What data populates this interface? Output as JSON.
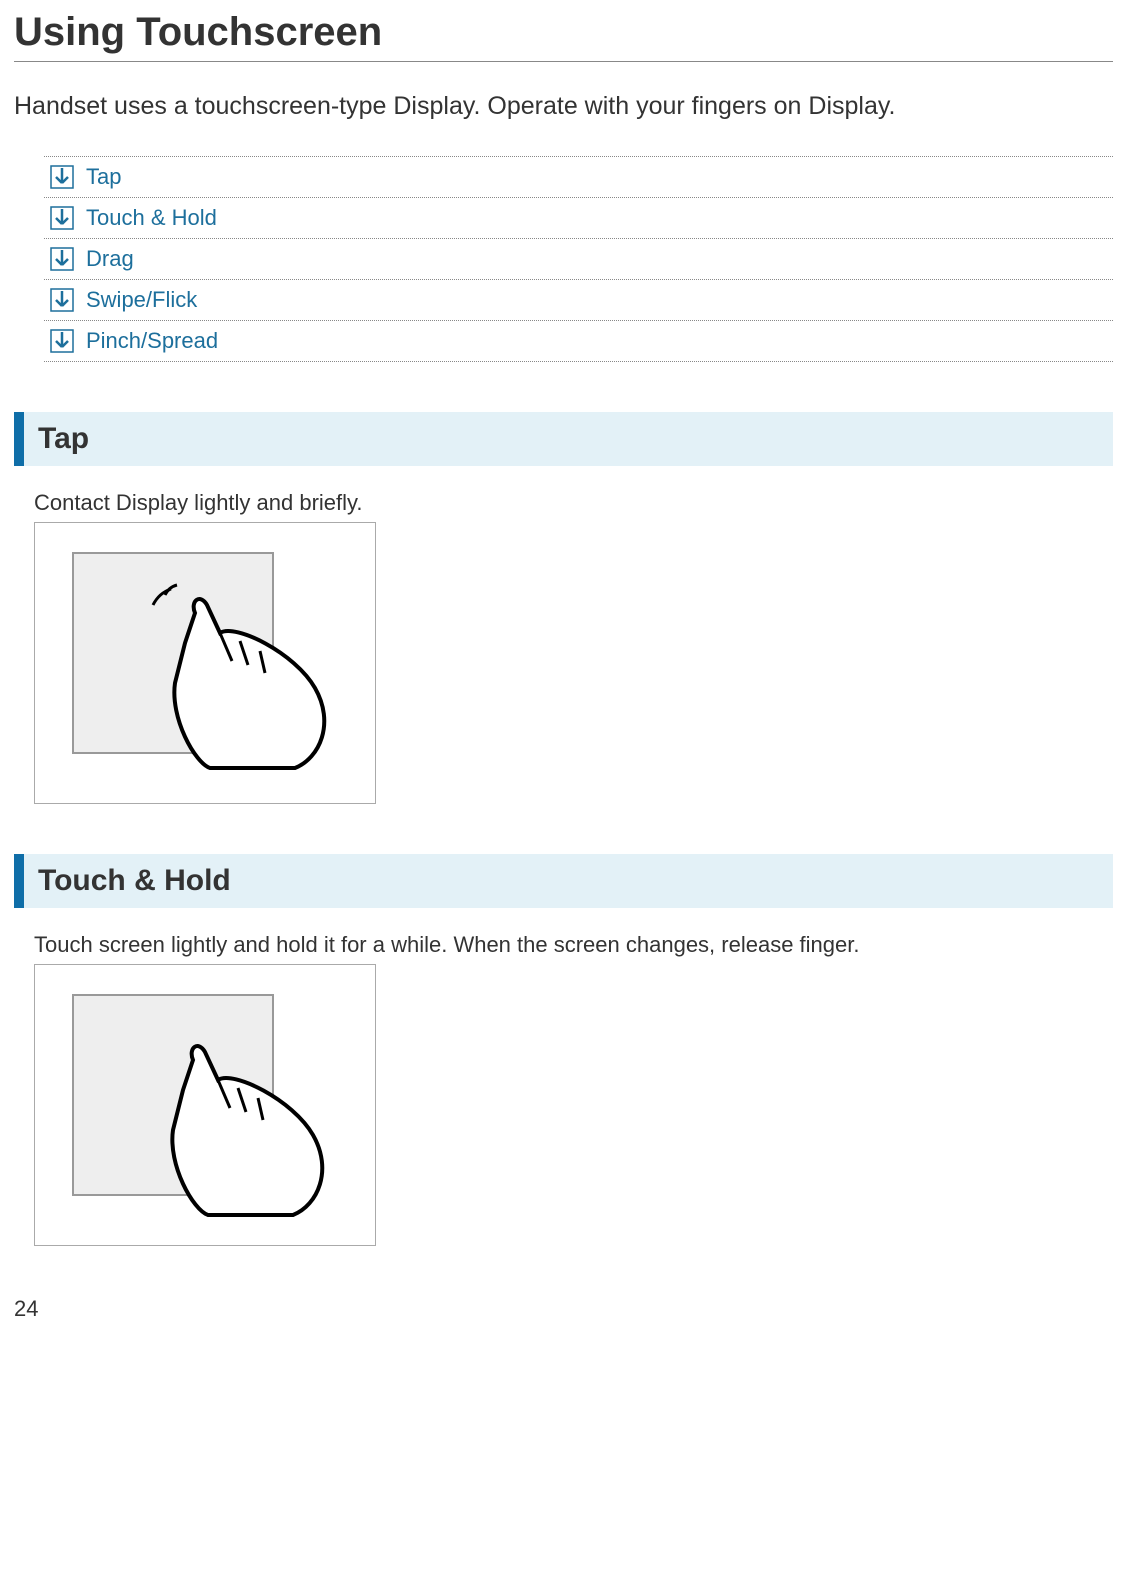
{
  "title": "Using Touchscreen",
  "intro": "Handset uses a touchscreen-type Display. Operate with your fingers on Display.",
  "toc": [
    {
      "label": "Tap"
    },
    {
      "label": "Touch & Hold"
    },
    {
      "label": "Drag"
    },
    {
      "label": "Swipe/Flick"
    },
    {
      "label": "Pinch/Spread"
    }
  ],
  "sections": [
    {
      "heading": "Tap",
      "desc": "Contact Display lightly and briefly."
    },
    {
      "heading": "Touch & Hold",
      "desc": "Touch screen lightly and hold it for a while. When the screen changes, release finger."
    }
  ],
  "page_number": "24"
}
